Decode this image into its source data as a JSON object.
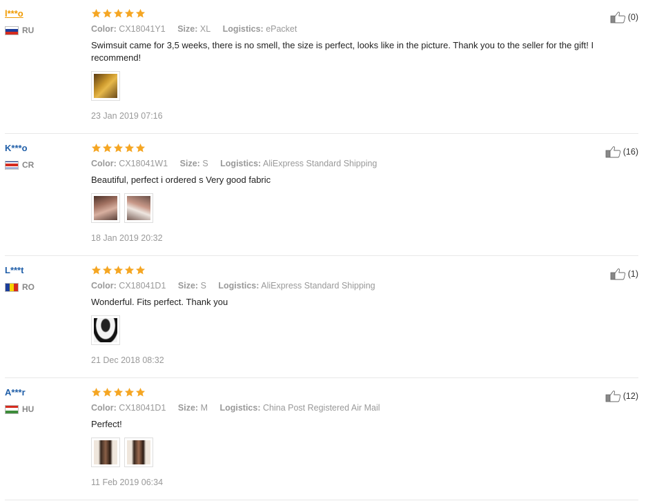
{
  "labels": {
    "color": "Color:",
    "size": "Size:",
    "logistics": "Logistics:"
  },
  "reviews": [
    {
      "user": "l***o",
      "country": "RU",
      "flag": [
        "#ffffff",
        "#1c3d9b",
        "#d52b1e"
      ],
      "color": "CX18041Y1",
      "size": "XL",
      "logistics": "ePacket",
      "text": "Swimsuit came for 3,5 weeks, there is no smell, the size is perfect, looks like in the picture. Thank you to the seller for the gift! I recommend!",
      "date": "23 Jan 2019 07:16",
      "helpful": "(0)",
      "photos": 1
    },
    {
      "user": "K***o",
      "country": "CR",
      "flag": [
        "#1c3d9b",
        "#ffffff",
        "#d52b1e",
        "#ffffff",
        "#1c3d9b"
      ],
      "color": "CX18041W1",
      "size": "S",
      "logistics": "AliExpress Standard Shipping",
      "text": "Beautiful, perfect i ordered s Very good fabric",
      "date": "18 Jan 2019 20:32",
      "helpful": "(16)",
      "photos": 2
    },
    {
      "user": "L***t",
      "country": "RO",
      "flag": [
        "#1c3d9b",
        "#f6d200",
        "#d52b1e"
      ],
      "color": "CX18041D1",
      "size": "S",
      "logistics": "AliExpress Standard Shipping",
      "text": "Wonderful. Fits perfect. Thank you",
      "date": "21 Dec 2018 08:32",
      "helpful": "(1)",
      "photos": 1
    },
    {
      "user": "A***r",
      "country": "HU",
      "flag": [
        "#d52b1e",
        "#ffffff",
        "#3d8c3a"
      ],
      "color": "CX18041D1",
      "size": "M",
      "logistics": "China Post Registered Air Mail",
      "text": "Perfect!",
      "date": "11 Feb 2019 06:34",
      "helpful": "(12)",
      "photos": 2
    }
  ],
  "colors": {
    "star": "#f5a623",
    "username": "#1f5ea8",
    "username_highlight": "#f09a00"
  },
  "icons": {
    "rating": "star-icon",
    "helpful": "thumbs-up-icon"
  }
}
